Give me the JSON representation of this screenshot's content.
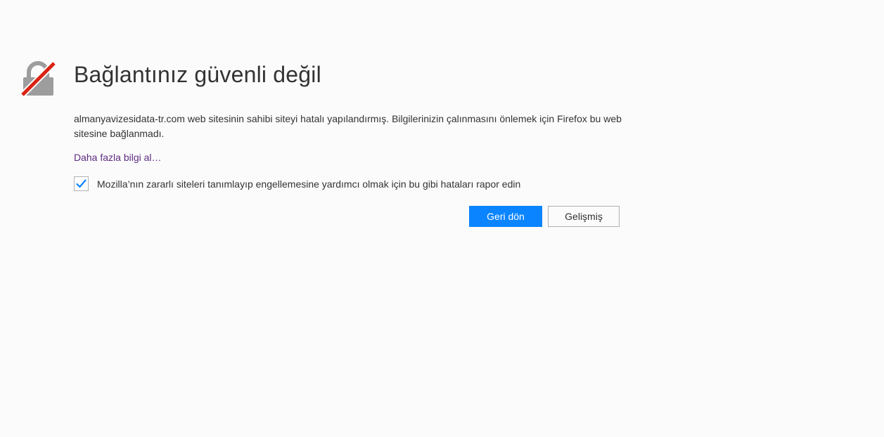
{
  "error_page": {
    "title": "Bağlantınız güvenli değil",
    "description": "almanyavizesidata-tr.com web sitesinin sahibi siteyi hatalı yapılandırmış. Bilgilerinizin çalınmasını önlemek için Firefox bu web sitesine bağlanmadı.",
    "learn_more": "Daha fazla bilgi al…",
    "report": {
      "checked": true,
      "label": "Mozilla’nın zararlı siteleri tanımlayıp engellemesine yardımcı olmak için bu gibi hataları rapor edin"
    },
    "buttons": {
      "go_back": "Geri dön",
      "advanced": "Gelişmiş"
    },
    "icon": "broken-lock-icon"
  },
  "colors": {
    "background": "#fbfbfc",
    "primary_button": "#0a84ff",
    "link": "#5e2b7f",
    "lock_gray": "#9d9d9d",
    "strike_red": "#d92215",
    "check_blue": "#0a84ff"
  }
}
